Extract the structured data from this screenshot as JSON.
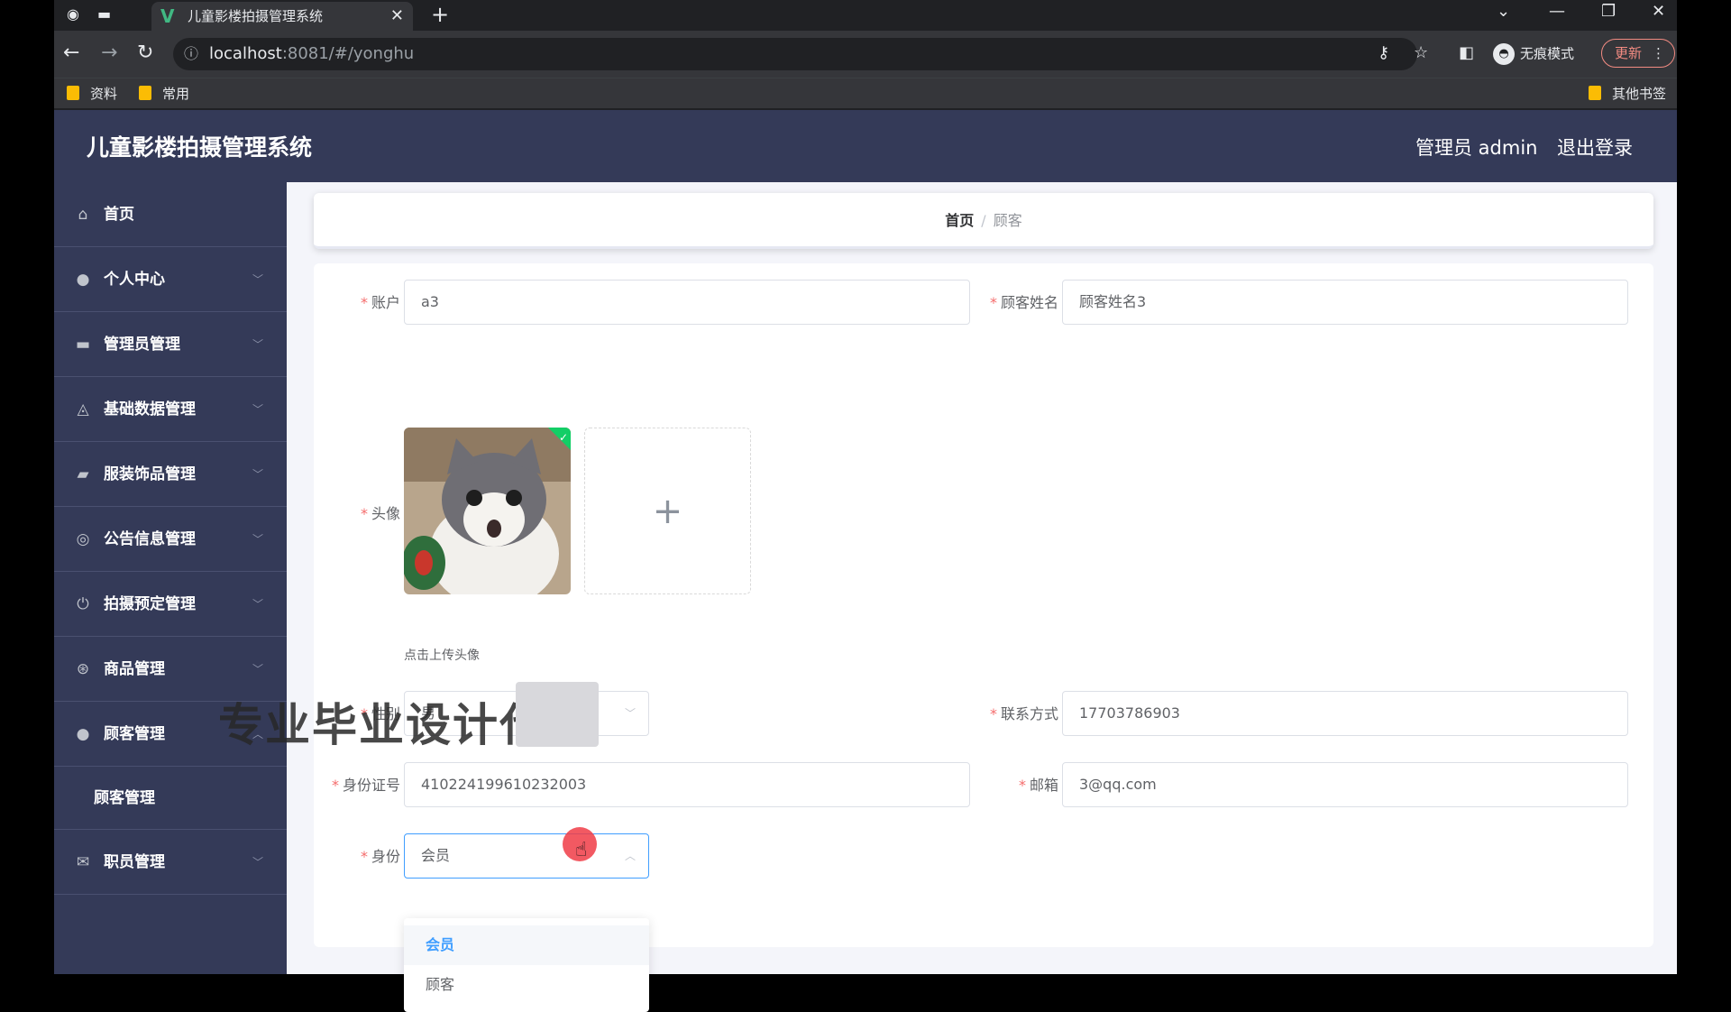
{
  "browser": {
    "tab_title": "儿童影楼拍摄管理系统",
    "url_host": "localhost",
    "url_path": ":8081/#/yonghu",
    "incognito_label": "无痕模式",
    "update_label": "更新",
    "bookmarks": [
      "资料",
      "常用"
    ],
    "other_bookmarks": "其他书签"
  },
  "app": {
    "title": "儿童影楼拍摄管理系统",
    "admin_label": "管理员 admin",
    "logout_label": "退出登录"
  },
  "sidebar": {
    "items": [
      {
        "label": "首页",
        "icon": "home-icon"
      },
      {
        "label": "个人中心",
        "icon": "user-icon"
      },
      {
        "label": "管理员管理",
        "icon": "monitor-icon"
      },
      {
        "label": "基础数据管理",
        "icon": "bell-icon"
      },
      {
        "label": "服装饰品管理",
        "icon": "ticket-icon"
      },
      {
        "label": "公告信息管理",
        "icon": "circle-icon"
      },
      {
        "label": "拍摄预定管理",
        "icon": "power-icon"
      },
      {
        "label": "商品管理",
        "icon": "compass-icon"
      },
      {
        "label": "顾客管理",
        "icon": "user-icon"
      }
    ],
    "sub_item": "顾客管理",
    "last_item": {
      "label": "职员管理",
      "icon": "mail-icon"
    }
  },
  "breadcrumb": {
    "home": "首页",
    "separator": "/",
    "current": "顾客"
  },
  "form": {
    "account_label": "账户",
    "account_value": "a3",
    "name_label": "顾客姓名",
    "name_value": "顾客姓名3",
    "avatar_label": "头像",
    "upload_tip": "点击上传头像",
    "gender_label": "性别",
    "gender_value": "男",
    "phone_label": "联系方式",
    "phone_value": "17703786903",
    "idcard_label": "身份证号",
    "idcard_value": "410224199610232003",
    "email_label": "邮箱",
    "email_value": "3@qq.com",
    "role_label": "身份",
    "role_value": "会员",
    "role_options": [
      "会员",
      "顾客"
    ]
  },
  "watermark": "专业毕业设计代做"
}
